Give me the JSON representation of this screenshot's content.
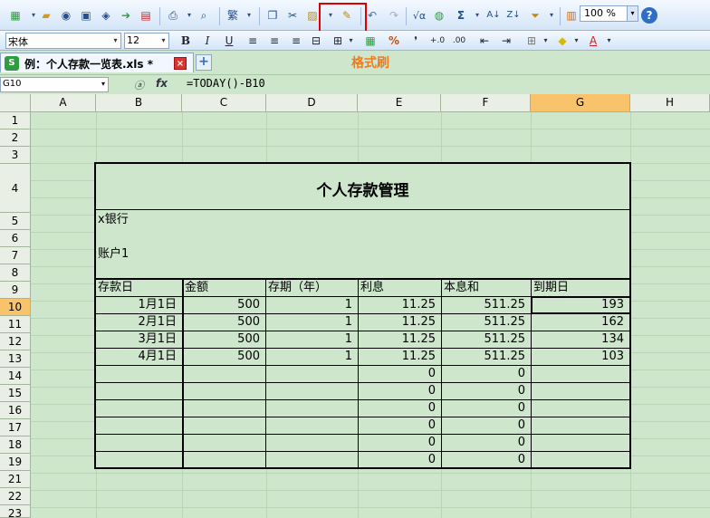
{
  "toolbar": {
    "zoom": "100 %",
    "font_name": "宋体",
    "font_size": "12",
    "bold": "B",
    "italic": "I",
    "underline": "U",
    "traditional": "繁",
    "sigma": "Σ",
    "percent": "%",
    "comma": "❜",
    "inc_decimal": "+.0",
    "dec_decimal": ".00",
    "help": "?"
  },
  "tab": {
    "filename": "例：个人存款一览表.xls *",
    "close": "×",
    "new": "+"
  },
  "annotation": "格式刷",
  "formula_bar": {
    "name_box": "G10",
    "formula": "=TODAY()-B10"
  },
  "sheet": {
    "columns": [
      "A",
      "B",
      "C",
      "D",
      "E",
      "F",
      "G",
      "H"
    ],
    "rows": [
      "1",
      "2",
      "3",
      "4",
      "5",
      "6",
      "7",
      "8",
      "9",
      "10",
      "11",
      "12",
      "13",
      "14",
      "15",
      "16",
      "17",
      "18",
      "19",
      "21",
      "22",
      "23"
    ],
    "title": "个人存款管理",
    "bank": "x银行",
    "account": "账户1",
    "headers": [
      "存款日",
      "金额",
      "存期（年）",
      "利息",
      "本息和",
      "到期日"
    ],
    "data": [
      [
        "1月1日",
        "500",
        "1",
        "11.25",
        "511.25",
        "193"
      ],
      [
        "2月1日",
        "500",
        "1",
        "11.25",
        "511.25",
        "162"
      ],
      [
        "3月1日",
        "500",
        "1",
        "11.25",
        "511.25",
        "134"
      ],
      [
        "4月1日",
        "500",
        "1",
        "11.25",
        "511.25",
        "103"
      ]
    ],
    "zeros": [
      "0",
      "0"
    ]
  }
}
